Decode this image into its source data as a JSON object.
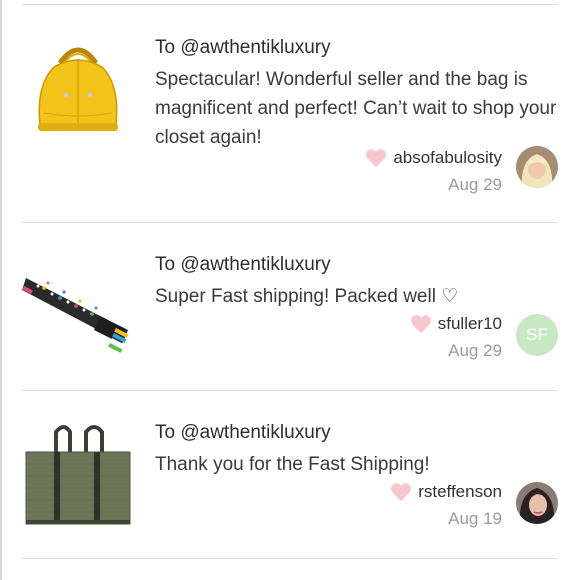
{
  "reviews": [
    {
      "to": "To @awthentikluxury",
      "message": "Spectacular! Wonderful seller and the bag is magnificent and perfect! Can’t wait to shop your closet again!",
      "username": "absofabulosity",
      "date": "Aug 29",
      "item_image": "yellow-handbag"
    },
    {
      "to": "To @awthentikluxury",
      "message": "Super Fast shipping! Packed well ♡",
      "username": "sfuller10",
      "date": "Aug 29",
      "avatar_initials": "SF",
      "item_image": "scarf"
    },
    {
      "to": "To @awthentikluxury",
      "message": "Thank you for the Fast Shipping!",
      "username": "rsteffenson",
      "date": "Aug 19",
      "item_image": "green-tote"
    }
  ],
  "colors": {
    "heart": "#f8c7cc",
    "initials_avatar_bg": "#c7e8c2",
    "divider": "#dcdcdc"
  }
}
